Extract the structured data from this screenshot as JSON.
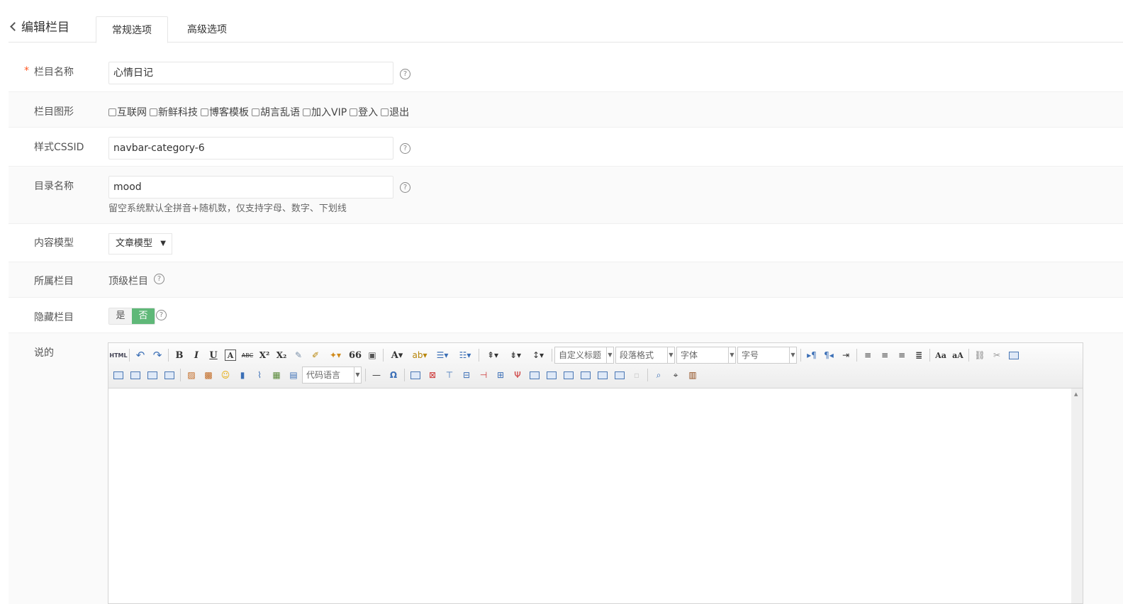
{
  "header": {
    "title": "编辑栏目",
    "tabs": [
      {
        "label": "常规选项"
      },
      {
        "label": "高级选项"
      }
    ]
  },
  "form": {
    "name": {
      "label": "栏目名称",
      "required_mark": "*",
      "value": "心情日记"
    },
    "graphics": {
      "label": "栏目图形",
      "options": [
        "互联网",
        "新鲜科技",
        "博客模板",
        "胡言乱语",
        "加入VIP",
        "登入",
        "退出"
      ]
    },
    "cssid": {
      "label": "样式CSSID",
      "value": "navbar-category-6"
    },
    "dir": {
      "label": "目录名称",
      "value": "mood",
      "hint": "留空系统默认全拼音+随机数，仅支持字母、数字、下划线"
    },
    "model": {
      "label": "内容模型",
      "value": "文章模型"
    },
    "parent": {
      "label": "所属栏目",
      "value": "顶级栏目"
    },
    "hidden": {
      "label": "隐藏栏目",
      "yes": "是",
      "no": "否",
      "selected": "否"
    },
    "desc": {
      "label": "说的"
    }
  },
  "editor": {
    "html_button": "HTML",
    "combos": {
      "heading": "自定义标题",
      "paragraph": "段落格式",
      "font": "字体",
      "size": "字号",
      "code_lang": "代码语言"
    },
    "glyphs": {
      "bold": "B",
      "italic": "I",
      "underline": "U",
      "fontborder": "A",
      "strike": "ABC",
      "sup": "X²",
      "sub": "X₂",
      "quote": "66",
      "forecolor": "A",
      "omega": "Ω",
      "hr": "—"
    }
  },
  "colors": {
    "accent": "#5fb878",
    "required": "#ff5722"
  }
}
